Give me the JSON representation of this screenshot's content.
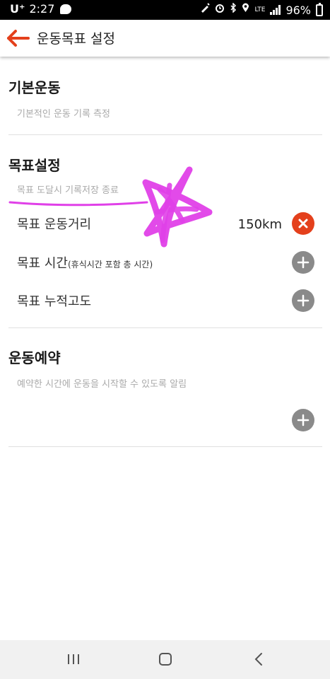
{
  "status_bar": {
    "carrier": "U⁺",
    "time": "2:27",
    "network": "LTE",
    "battery": "96%"
  },
  "app_bar": {
    "title": "운동목표 설정"
  },
  "sections": {
    "basic": {
      "title": "기본운동",
      "description": "기본적인 운동 기록 측정"
    },
    "goal": {
      "title": "목표설정",
      "description": "목표 도달시 기록저장 종료",
      "rows": [
        {
          "label": "목표 운동거리",
          "sub": "",
          "value": "150km",
          "action": "remove"
        },
        {
          "label": "목표 시간",
          "sub": "(휴식시간 포함 총 시간)",
          "value": "",
          "action": "add"
        },
        {
          "label": "목표 누적고도",
          "sub": "",
          "value": "",
          "action": "add"
        }
      ]
    },
    "reservation": {
      "title": "운동예약",
      "description": "예약한 시간에 운동을 시작할 수 있도록 알림"
    }
  },
  "colors": {
    "accent": "#e4401c",
    "add_button": "#8a8a8a",
    "annotation_ink": "#e040e8"
  }
}
